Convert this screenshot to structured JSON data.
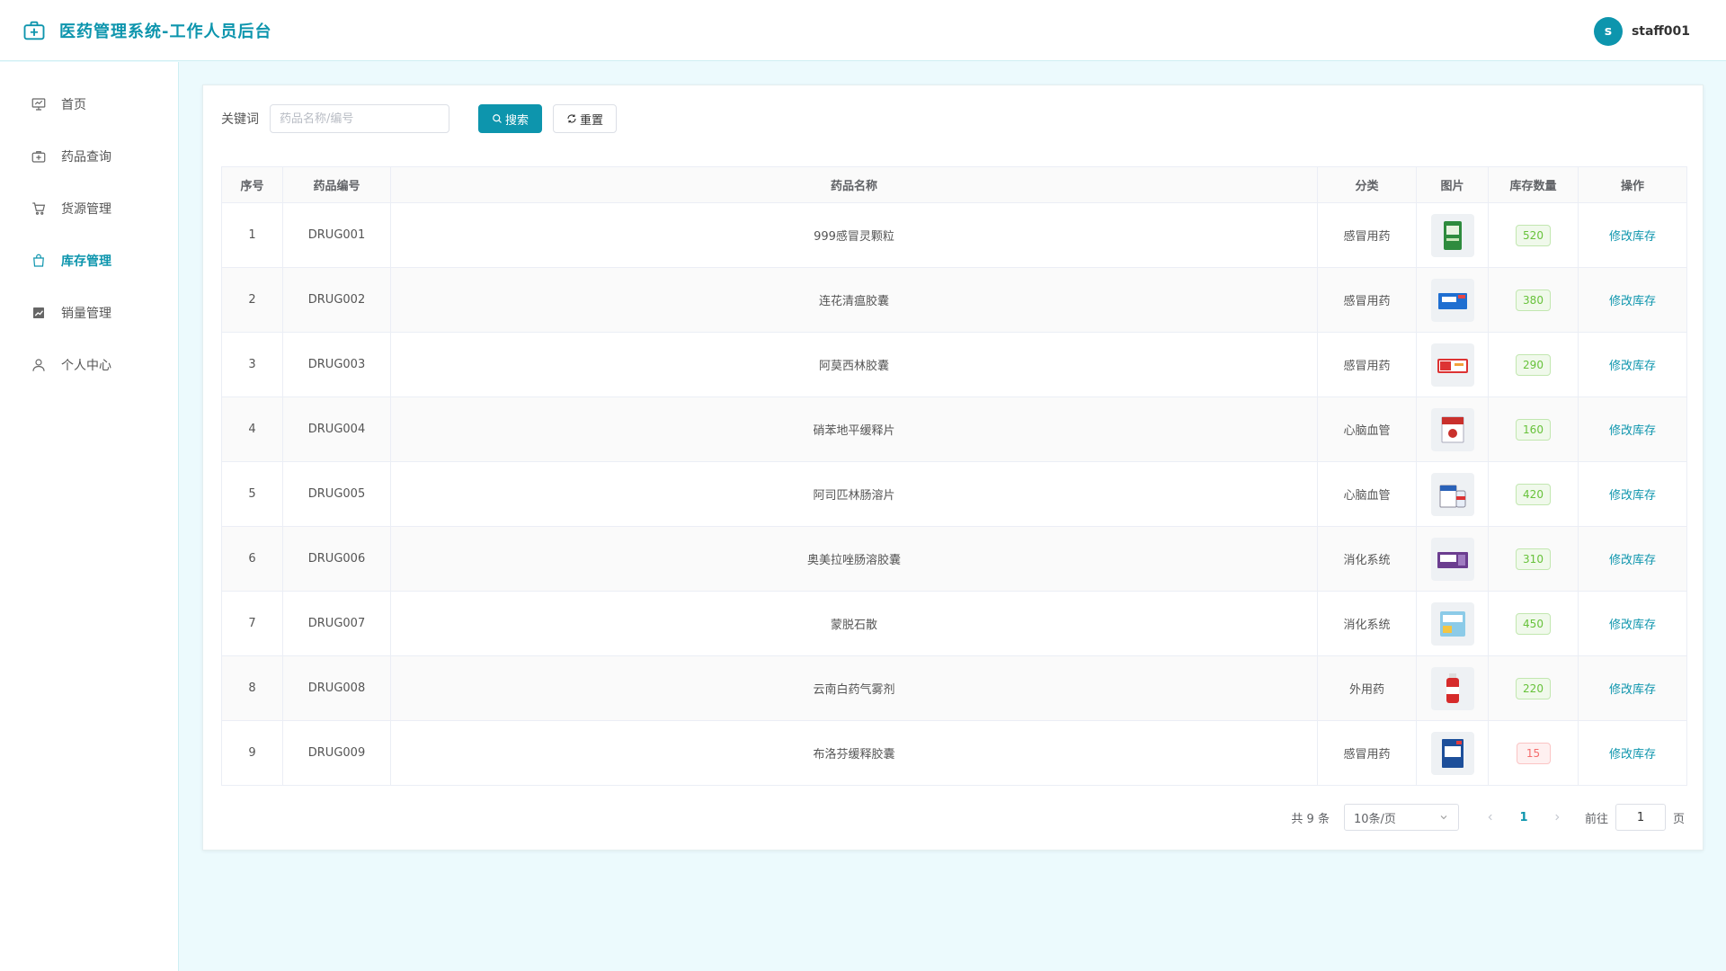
{
  "header": {
    "title": "医药管理系统-工作人员后台",
    "user_initial": "s",
    "user_name": "staff001"
  },
  "sidebar": {
    "items": [
      {
        "label": "首页",
        "icon": "presentation-board-icon",
        "active": false
      },
      {
        "label": "药品查询",
        "icon": "medical-kit-icon",
        "active": false
      },
      {
        "label": "货源管理",
        "icon": "shopping-cart-icon",
        "active": false
      },
      {
        "label": "库存管理",
        "icon": "shopping-bag-icon",
        "active": true
      },
      {
        "label": "销量管理",
        "icon": "trend-chart-icon",
        "active": false
      },
      {
        "label": "个人中心",
        "icon": "user-icon",
        "active": false
      }
    ]
  },
  "search": {
    "label": "关键词",
    "placeholder": "药品名称/编号",
    "value": "",
    "search_button": "搜索",
    "reset_button": "重置"
  },
  "table": {
    "headers": [
      "序号",
      "药品编号",
      "药品名称",
      "分类",
      "图片",
      "库存数量",
      "操作"
    ],
    "rows": [
      {
        "index": "1",
        "code": "DRUG001",
        "name": "999感冒灵颗粒",
        "category": "感冒用药",
        "stock": "520",
        "status": "ok",
        "action": "修改库存"
      },
      {
        "index": "2",
        "code": "DRUG002",
        "name": "连花清瘟胶囊",
        "category": "感冒用药",
        "stock": "380",
        "status": "ok",
        "action": "修改库存"
      },
      {
        "index": "3",
        "code": "DRUG003",
        "name": "阿莫西林胶囊",
        "category": "感冒用药",
        "stock": "290",
        "status": "ok",
        "action": "修改库存"
      },
      {
        "index": "4",
        "code": "DRUG004",
        "name": "硝苯地平缓释片",
        "category": "心脑血管",
        "stock": "160",
        "status": "ok",
        "action": "修改库存"
      },
      {
        "index": "5",
        "code": "DRUG005",
        "name": "阿司匹林肠溶片",
        "category": "心脑血管",
        "stock": "420",
        "status": "ok",
        "action": "修改库存"
      },
      {
        "index": "6",
        "code": "DRUG006",
        "name": "奥美拉唑肠溶胶囊",
        "category": "消化系统",
        "stock": "310",
        "status": "ok",
        "action": "修改库存"
      },
      {
        "index": "7",
        "code": "DRUG007",
        "name": "蒙脱石散",
        "category": "消化系统",
        "stock": "450",
        "status": "ok",
        "action": "修改库存"
      },
      {
        "index": "8",
        "code": "DRUG008",
        "name": "云南白药气雾剂",
        "category": "外用药",
        "stock": "220",
        "status": "ok",
        "action": "修改库存"
      },
      {
        "index": "9",
        "code": "DRUG009",
        "name": "布洛芬缓释胶囊",
        "category": "感冒用药",
        "stock": "15",
        "status": "low",
        "action": "修改库存"
      }
    ]
  },
  "pagination": {
    "total": "共 9 条",
    "page_size": "10条/页",
    "current_page": "1",
    "goto_prefix": "前往",
    "goto_value": "1",
    "goto_suffix": "页"
  },
  "colors": {
    "primary": "#0d95ad",
    "stock_ok": "#67c23a",
    "stock_low": "#f56c6c",
    "background": "#ecfafd"
  }
}
